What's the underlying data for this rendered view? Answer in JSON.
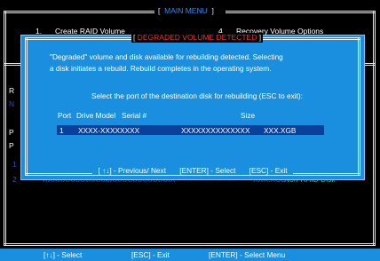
{
  "main_menu": {
    "title": "MAIN MENU",
    "bracket_left": "[",
    "bracket_right": "]",
    "items": [
      {
        "num": "1.",
        "label": "Create RAID Volume"
      },
      {
        "num": "4.",
        "label": "Recovery Volume Options"
      }
    ]
  },
  "background": {
    "left_r": "R",
    "left_n": "N",
    "left_p1": "P",
    "left_p2": "P",
    "left_1": "1",
    "left_2": "2",
    "disk_row": {
      "port": "2",
      "model": "XXXXXXXXXXXXX",
      "serial": "XXXXXXXXXXXXXX",
      "size": "XXX.XGB",
      "status": "Non-RAID Disk"
    }
  },
  "dialog": {
    "title": "DEGRADED VOLUME DETECTED",
    "bracket_left": "[",
    "bracket_right": "]",
    "message_line1": "\"Degraded\" volume and disk available for rebuilding detected. Selecting",
    "message_line2": "a disk initiates a rebuild. Rebuild completes in the  operating system.",
    "prompt": "Select the port of the destination disk for rebuilding (ESC to exit):",
    "table": {
      "headers": {
        "port": "Port",
        "drive_model": "Drive  Model",
        "serial": "Serial #",
        "size": "Size"
      },
      "rows": [
        {
          "port": "1",
          "model": "XXXX-XXXXXXXX",
          "serial": "XXXXXXXXXXXXXX",
          "size": "XXX.XGB"
        }
      ]
    },
    "footer": {
      "nav": "[ ↑↓] - Previous/ Next",
      "enter": "[ENTER] - Select",
      "esc": "[ESC] - Exit"
    }
  },
  "status_bar": {
    "select": "[↑↓] - Select",
    "exit": "[ESC] - Exit",
    "menu": "[ENTER] - Select Menu"
  },
  "colors": {
    "background": "#000000",
    "dialog_bg": "#1a8fe0",
    "selected_row": "#0a3f9a",
    "title_red": "#ff2a2a",
    "menu_title_blue": "#1e90ff",
    "non_raid_green": "#1fc46a"
  }
}
